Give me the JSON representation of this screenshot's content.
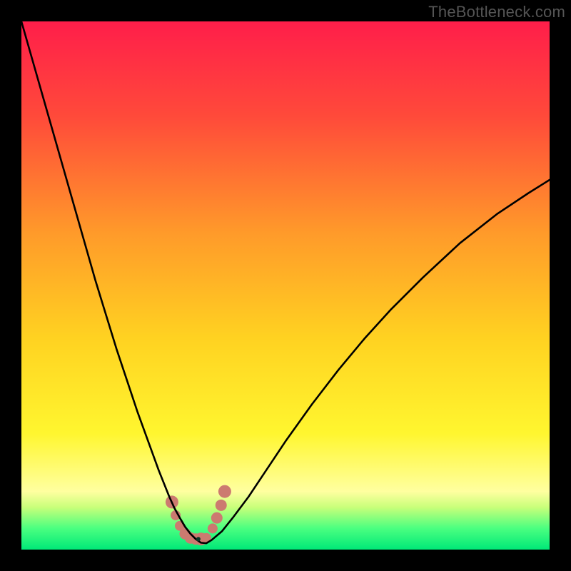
{
  "watermark": "TheBottleneck.com",
  "chart_data": {
    "type": "line",
    "title": "",
    "xlabel": "",
    "ylabel": "",
    "xlim": [
      0,
      100
    ],
    "ylim": [
      0,
      100
    ],
    "background_gradient": {
      "stops": [
        {
          "offset": 0.0,
          "color": "#ff1e4a"
        },
        {
          "offset": 0.18,
          "color": "#ff4a3a"
        },
        {
          "offset": 0.4,
          "color": "#ff9a2a"
        },
        {
          "offset": 0.6,
          "color": "#ffd221"
        },
        {
          "offset": 0.78,
          "color": "#fff62f"
        },
        {
          "offset": 0.89,
          "color": "#ffffa0"
        },
        {
          "offset": 0.92,
          "color": "#c8ff7a"
        },
        {
          "offset": 0.96,
          "color": "#4aff80"
        },
        {
          "offset": 1.0,
          "color": "#00e878"
        }
      ]
    },
    "series": [
      {
        "name": "bottleneck-curve",
        "color": "#000000",
        "width": 2.6,
        "x": [
          0.0,
          2.0,
          4.0,
          6.0,
          8.0,
          10.0,
          12.0,
          14.0,
          16.0,
          18.0,
          20.0,
          22.0,
          24.0,
          26.0,
          27.0,
          28.0,
          29.0,
          30.0,
          31.0,
          32.0,
          33.0,
          34.0,
          35.0,
          36.0,
          38.0,
          40.0,
          43.0,
          46.0,
          50.0,
          55.0,
          60.0,
          65.0,
          70.0,
          76.0,
          83.0,
          90.0,
          96.0,
          100.0
        ],
        "y": [
          100.0,
          93.0,
          86.0,
          79.0,
          72.0,
          65.0,
          58.0,
          51.0,
          44.5,
          38.0,
          32.0,
          26.0,
          20.5,
          15.0,
          12.5,
          10.0,
          7.8,
          6.0,
          4.3,
          3.0,
          2.0,
          1.3,
          1.2,
          1.8,
          3.5,
          6.0,
          10.0,
          14.5,
          20.5,
          27.5,
          34.0,
          40.0,
          45.5,
          51.5,
          58.0,
          63.5,
          67.5,
          70.0
        ]
      }
    ],
    "markers": {
      "name": "near-minimum-cluster",
      "color": "#cc7a70",
      "points": [
        {
          "x": 28.5,
          "y": 9.0,
          "r": 9
        },
        {
          "x": 29.2,
          "y": 6.5,
          "r": 7
        },
        {
          "x": 30.0,
          "y": 4.5,
          "r": 7
        },
        {
          "x": 31.0,
          "y": 3.0,
          "r": 8
        },
        {
          "x": 32.0,
          "y": 2.2,
          "r": 8
        },
        {
          "x": 33.0,
          "y": 2.0,
          "r": 8
        },
        {
          "x": 34.0,
          "y": 2.0,
          "r": 9
        },
        {
          "x": 35.0,
          "y": 2.2,
          "r": 7
        },
        {
          "x": 36.2,
          "y": 4.0,
          "r": 7
        },
        {
          "x": 37.0,
          "y": 6.0,
          "r": 8
        },
        {
          "x": 37.8,
          "y": 8.4,
          "r": 8
        },
        {
          "x": 38.5,
          "y": 11.0,
          "r": 9
        }
      ],
      "center_dot": {
        "x": 33.5,
        "y": 2.0,
        "r": 3,
        "color": "#0a3a2a"
      }
    }
  }
}
